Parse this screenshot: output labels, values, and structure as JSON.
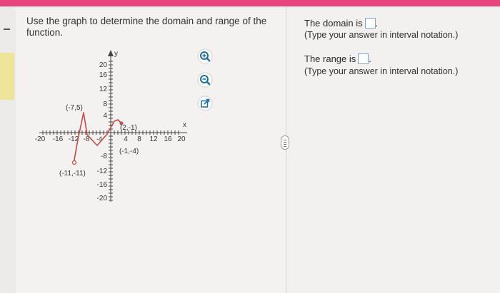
{
  "question": {
    "text": "Use the graph to determine the domain and range of the function."
  },
  "answers": {
    "domain_label": "The domain is",
    "domain_hint": "(Type your answer in interval notation.)",
    "range_label": "The range is",
    "range_hint": "(Type your answer in interval notation.)",
    "domain_value": "",
    "range_value": ""
  },
  "graph": {
    "x_axis_label": "x",
    "y_axis_label": "y",
    "x_ticks_neg": [
      "-20",
      "-16",
      "-12",
      "-8",
      "-4"
    ],
    "x_ticks_pos": [
      "4",
      "8",
      "12",
      "16",
      "20"
    ],
    "y_ticks_pos": [
      "20",
      "16",
      "12",
      "8",
      "4"
    ],
    "y_ticks_neg": [
      "-8",
      "-12",
      "-16",
      "-20"
    ],
    "points": {
      "p1": "(-7,5)",
      "p2": "(2,-1)",
      "p3": "(-1,-4)",
      "p4": "(-11,-11)"
    }
  },
  "tools": [
    "zoom-in-icon",
    "zoom-out-icon",
    "open-external-icon"
  ],
  "colors": {
    "accent_bar": "#e8447e",
    "curve": "#c94a4a",
    "input_border": "#7fa8cf",
    "tool_icon": "#1a6ea8"
  }
}
